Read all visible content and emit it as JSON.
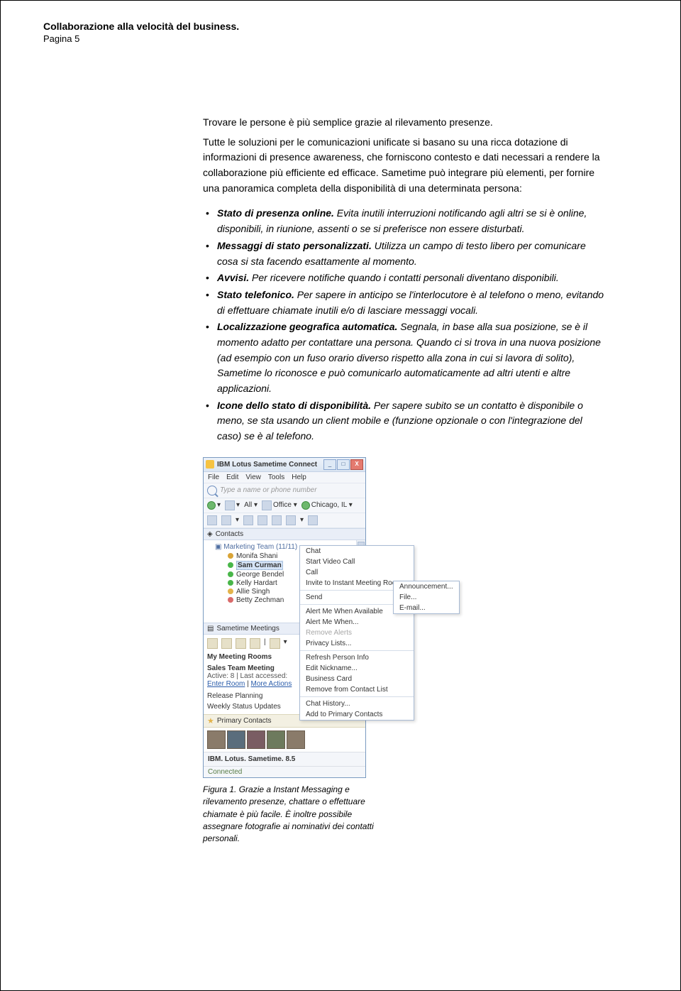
{
  "header": {
    "title": "Collaborazione alla velocità del business.",
    "page_label": "Pagina 5"
  },
  "section": {
    "subheading": "Trovare le persone è più semplice grazie al rilevamento presenze.",
    "intro": "Tutte le soluzioni per le comunicazioni unificate si basano su una ricca dotazione di informazioni di presence awareness, che forniscono contesto e dati necessari a rendere la collaborazione più efficiente ed efficace. Sametime può integrare più elementi, per fornire una panoramica completa della disponibilità di una determinata persona:",
    "bullets": [
      {
        "label": "Stato di presenza online.",
        "text": " Evita inutili interruzioni notificando agli altri se si è online, disponibili, in riunione, assenti o se si preferisce non essere disturbati."
      },
      {
        "label": "Messaggi di stato personalizzati.",
        "text": " Utilizza un campo di testo libero per comunicare cosa si sta facendo esattamente al momento."
      },
      {
        "label": "Avvisi.",
        "text": " Per ricevere notifiche quando i contatti personali diventano disponibili."
      },
      {
        "label": "Stato telefonico.",
        "text": " Per sapere in anticipo se l'interlocutore è al telefono o meno, evitando di effettuare chiamate inutili e/o di lasciare messaggi vocali."
      },
      {
        "label": "Localizzazione geografica automatica.",
        "text": " Segnala, in base alla sua posizione, se è il momento adatto per contattare una persona. Quando ci si trova in una nuova posizione (ad esempio con un fuso orario diverso rispetto alla zona in cui si lavora di solito), Sametime lo riconosce e può comunicarlo automaticamente ad altri utenti e altre applicazioni."
      },
      {
        "label": "Icone dello stato di disponibilità.",
        "text": " Per sapere subito se un contatto è disponibile o meno, se sta usando un client mobile e (funzione opzionale o con l'integrazione del caso) se è al telefono."
      }
    ]
  },
  "app": {
    "title": "IBM Lotus Sametime Connect",
    "menus": {
      "file": "File",
      "edit": "Edit",
      "view": "View",
      "tools": "Tools",
      "help": "Help"
    },
    "search_placeholder": "Type a name or phone number",
    "filters": {
      "all": "All ▾",
      "office": "Office ▾",
      "location": "Chicago, IL ▾"
    },
    "contacts_label": "Contacts",
    "group": {
      "label": "Marketing Team (11/11)",
      "people": [
        {
          "name": "Monifa Shani",
          "presence": "tel"
        },
        {
          "name": "Sam Curman",
          "presence": "avail",
          "selected": true
        },
        {
          "name": "George Bendel",
          "presence": "avail"
        },
        {
          "name": "Kelly Hardart",
          "presence": "avail"
        },
        {
          "name": "Allie Singh",
          "presence": "diamond"
        },
        {
          "name": "Betty Zechman",
          "presence": "dnd"
        }
      ]
    },
    "meetings": {
      "header": "Sametime Meetings",
      "rooms_label": "My Meeting Rooms",
      "room_name": "Sales Team Meeting",
      "room_sub": "Active: 8 | Last accessed:",
      "link_enter": "Enter Room",
      "link_more": "More Actions",
      "room2": "Release Planning",
      "room3": "Weekly Status Updates"
    },
    "primary_label": "Primary Contacts",
    "branding": "IBM. Lotus. Sametime. 8.5",
    "status": "Connected",
    "ctx": {
      "chat": "Chat",
      "start_video": "Start Video Call",
      "call": "Call",
      "invite": "Invite to Instant Meeting Room...",
      "send": "Send",
      "alert_avail": "Alert Me When Available",
      "alert_when": "Alert Me When...",
      "remove_alerts": "Remove Alerts",
      "privacy": "Privacy Lists...",
      "refresh": "Refresh Person Info",
      "edit_nick": "Edit Nickname...",
      "bcard": "Business Card",
      "remove_contact": "Remove from Contact List",
      "chat_history": "Chat History...",
      "add_primary": "Add to Primary Contacts"
    },
    "ctx_sub": {
      "announcement": "Announcement...",
      "file": "File...",
      "email": "E-mail..."
    }
  },
  "caption": "Figura 1. Grazie a Instant Messaging e rilevamento presenze, chattare o effettuare chiamate è più facile. È inoltre possibile assegnare fotografie ai nominativi dei contatti personali."
}
